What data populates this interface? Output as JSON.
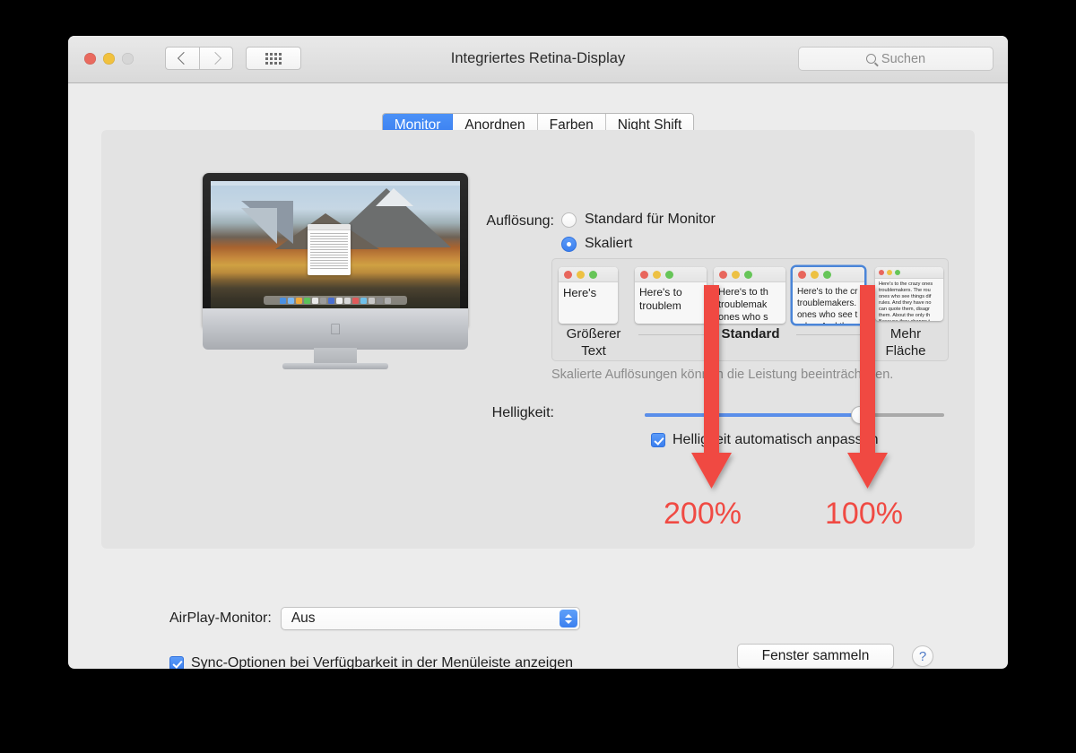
{
  "window": {
    "title": "Integriertes Retina-Display",
    "traffic_lights": [
      "close-red",
      "minimize-yellow",
      "zoom-disabled"
    ],
    "nav": {
      "back": "back-chevron",
      "forward": "forward-chevron",
      "show_all": "show-all-grid"
    },
    "search": {
      "placeholder": "Suchen",
      "icon": "search-icon"
    }
  },
  "tabs": [
    {
      "label": "Monitor",
      "active": true
    },
    {
      "label": "Anordnen",
      "active": false
    },
    {
      "label": "Farben",
      "active": false
    },
    {
      "label": "Night Shift",
      "active": false
    }
  ],
  "display_preview": {
    "device": "imac",
    "logo": "apple-logo",
    "wallpaper": "macos-high-sierra-mountain-lake"
  },
  "resolution": {
    "label": "Auflösung:",
    "options": [
      {
        "label": "Standard für Monitor",
        "selected": false
      },
      {
        "label": "Skaliert",
        "selected": true
      }
    ],
    "hint": "Skalierte Auflösungen können die Leistung beeinträchtigen.",
    "thumbnails": [
      {
        "id": "res-1",
        "text": "Here's",
        "selected": false
      },
      {
        "id": "res-2",
        "text": "Here's to\ntroublem",
        "selected": false
      },
      {
        "id": "res-3",
        "text": "Here's to th\ntroublemak\nones who s",
        "selected": false
      },
      {
        "id": "res-4",
        "text": "Here's to the cr\ntroublemakers.\nones who see t\nrules. And they",
        "selected": true
      },
      {
        "id": "res-5",
        "text": "Here's to the crazy ones\ntroublemakers. The rou\nones who see things dif\nrules. And they have no\ncan quote them, disagr\nthem. About the only th\nBecause they change t",
        "selected": false
      }
    ],
    "captions": {
      "smaller": "Größerer\nText",
      "standard": "Standard",
      "larger": "Mehr\nFläche"
    }
  },
  "brightness": {
    "label": "Helligkeit:",
    "value_percent": 72,
    "auto_label": "Helligkeit automatisch anpassen",
    "auto_checked": true
  },
  "airplay": {
    "label": "AirPlay-Monitor:",
    "value": "Aus",
    "options": [
      "Aus"
    ]
  },
  "sync_option": {
    "label": "Sync-Optionen bei Verfügbarkeit in der Menüleiste anzeigen",
    "checked": true
  },
  "footer": {
    "collect_windows": "Fenster sammeln",
    "help": "?"
  },
  "annotations": {
    "color": "#f04a43",
    "arrows": [
      {
        "id": "arrow-200",
        "label": "200%",
        "target": "res-3"
      },
      {
        "id": "arrow-100",
        "label": "100%",
        "target": "res-5"
      }
    ],
    "label_200": "200%",
    "label_100": "100%"
  }
}
